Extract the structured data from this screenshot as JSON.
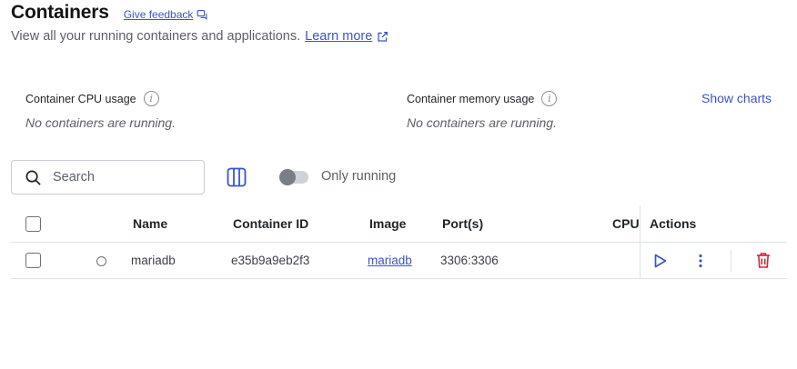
{
  "header": {
    "title": "Containers",
    "feedback_label": "Give feedback",
    "subtitle": "View all your running containers and applications.",
    "learn_more_label": "Learn more"
  },
  "usage": {
    "cpu_title": "Container CPU usage",
    "cpu_empty": "No containers are running.",
    "memory_title": "Container memory usage",
    "memory_empty": "No containers are running.",
    "show_charts_label": "Show charts"
  },
  "toolbar": {
    "search_placeholder": "Search",
    "search_value": "",
    "only_running_label": "Only running",
    "only_running_enabled": false
  },
  "table": {
    "columns": {
      "name": "Name",
      "container_id": "Container ID",
      "image": "Image",
      "ports": "Port(s)",
      "cpu": "CPU",
      "actions": "Actions"
    },
    "rows": [
      {
        "name": "mariadb",
        "container_id": "e35b9a9eb2f3",
        "image": "mariadb",
        "ports": "3306:3306",
        "status": "stopped"
      }
    ]
  },
  "icons": {
    "feedback": "chat-bubble-icon",
    "learn_more": "external-link-icon",
    "info": "info-icon",
    "search": "search-icon",
    "columns": "columns-icon",
    "start": "play-icon",
    "more": "more-vertical-icon",
    "delete": "trash-icon"
  },
  "colors": {
    "accent": "#3a55c8",
    "danger": "#c8283c",
    "muted_text": "#5b5f66",
    "border": "#dfe2e6"
  }
}
